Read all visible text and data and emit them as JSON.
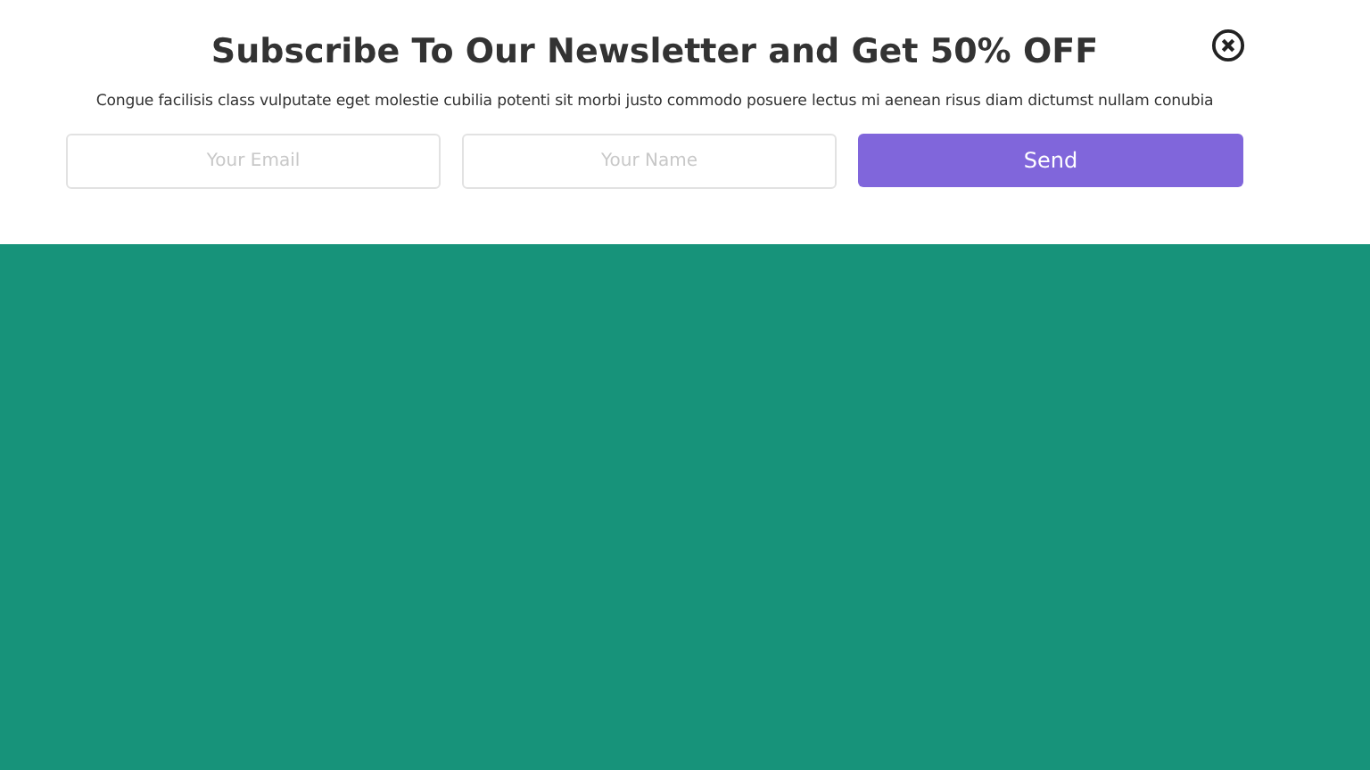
{
  "banner": {
    "title": "Subscribe To Our Newsletter and Get 50% OFF",
    "description": "Congue facilisis class vulputate eget molestie cubilia potenti sit morbi justo commodo posuere lectus mi aenean risus diam dictumst nullam conubia",
    "fields": [
      {
        "placeholder": "Your Email"
      },
      {
        "placeholder": "Your Name"
      }
    ],
    "button": "Send"
  }
}
